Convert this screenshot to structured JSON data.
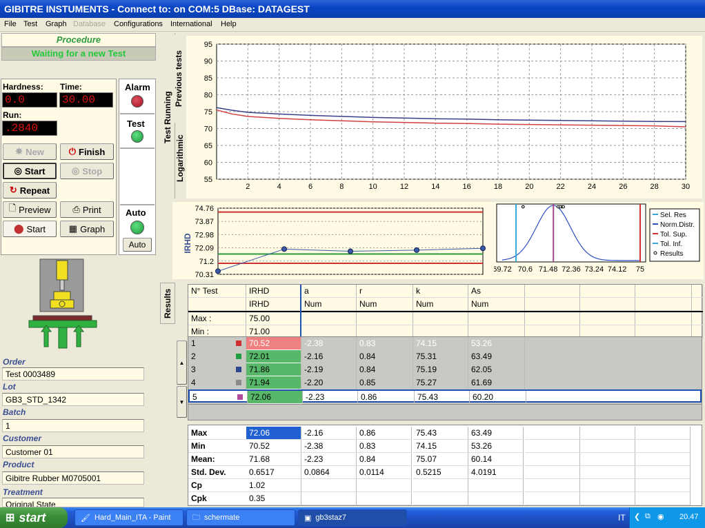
{
  "window": {
    "title": "GIBITRE INSTUMENTS - Connect to:  on COM:5  DBase: DATAGEST"
  },
  "menu": [
    "File",
    "Test",
    "Graph",
    "Database",
    "Configurations",
    "International",
    "Help"
  ],
  "procedure": {
    "title": "Procedure",
    "status": "Waiting for a new Test"
  },
  "readings": {
    "hardness_label": "Hardness:",
    "hardness_value": "0.0",
    "time_label": "Time:",
    "time_value": "30.00",
    "run_label": "Run:",
    "run_value": ".2840"
  },
  "buttons": {
    "new": "New",
    "finish": "Finish",
    "start": "Start",
    "stop": "Stop",
    "repeat": "Repeat",
    "preview": "Preview",
    "print": "Print",
    "start2": "Start",
    "graph": "Graph",
    "auto": "Auto"
  },
  "indicators": {
    "alarm": "Alarm",
    "test": "Test",
    "auto": "Auto"
  },
  "info": {
    "order_label": "Order",
    "order": "Test 0003489",
    "lot_label": "Lot",
    "lot": "GB3_STD_1342",
    "batch_label": "Batch",
    "batch": "1",
    "customer_label": "Customer",
    "customer": "Customer 01",
    "product_label": "Product",
    "product": "Gibitre Rubber M0705001",
    "treatment_label": "Treatment",
    "treatment": "Original State"
  },
  "side_tabs": {
    "previous": "Previous tests",
    "running": "Test Running",
    "log": "Logarithmic",
    "results": "Results"
  },
  "colors": {
    "red_curve": "#d04040",
    "blue_curve": "#3a3d8a",
    "green_led": "#22b24a",
    "red_led": "#b01828",
    "highlight": "#2060d0"
  },
  "chart_data": [
    {
      "type": "line",
      "x_ticks": [
        2,
        4,
        6,
        8,
        10,
        12,
        14,
        16,
        18,
        20,
        22,
        24,
        26,
        28,
        30
      ],
      "y_ticks": [
        55,
        60,
        65,
        70,
        75,
        80,
        85,
        90,
        95
      ],
      "xlim": [
        0,
        30
      ],
      "ylim": [
        55,
        95
      ],
      "grid": true,
      "series": [
        {
          "color": "blue",
          "x": [
            0,
            1,
            2,
            4,
            6,
            8,
            10,
            12,
            14,
            16,
            18,
            20,
            22,
            24,
            26,
            28,
            30
          ],
          "y": [
            76.2,
            75.4,
            74.8,
            74.3,
            73.9,
            73.6,
            73.3,
            73.1,
            72.9,
            72.8,
            72.6,
            72.5,
            72.4,
            72.3,
            72.2,
            72.1,
            72.06
          ]
        },
        {
          "color": "red",
          "x": [
            0,
            1,
            2,
            4,
            6,
            8,
            10,
            12,
            14,
            16,
            18,
            20,
            22,
            24,
            26,
            28,
            30
          ],
          "y": [
            75.5,
            74.3,
            73.6,
            73.0,
            72.6,
            72.3,
            72.0,
            71.8,
            71.6,
            71.5,
            71.3,
            71.2,
            71.1,
            71.0,
            70.9,
            70.8,
            70.52
          ]
        }
      ]
    },
    {
      "type": "line",
      "ylabel": "IRHD",
      "y_ticks": [
        "74.76",
        "73.87",
        "72.98",
        "72.09",
        "71.2",
        "70.31"
      ],
      "ylim": [
        70.31,
        74.76
      ],
      "x": [
        1,
        2,
        3,
        4,
        5
      ],
      "values": [
        70.52,
        72.01,
        71.86,
        71.94,
        72.06
      ],
      "mean": 71.68,
      "upper_limit": 74.5,
      "lower_limit": 71.05
    },
    {
      "type": "line",
      "x_ticks": [
        "69.72",
        "70.6",
        "71.48",
        "72.36",
        "73.24",
        "74.12",
        "75"
      ],
      "xlim": [
        69.72,
        75
      ],
      "legend": [
        "Sel. Res",
        "Norm.Distr.",
        "Tol. Sup.",
        "Tol. Inf.",
        "Results"
      ],
      "legend_position": "right",
      "mean": 71.68,
      "std": 0.6517,
      "sel_res": 71.68,
      "tol_sup": 75.0,
      "tol_inf": 70.25,
      "results": [
        70.52,
        72.01,
        71.86,
        71.94,
        72.06
      ]
    },
    {
      "type": "table",
      "columns": [
        {
          "name": "N° Test",
          "unit": ""
        },
        {
          "name": "IRHD",
          "unit": "IRHD"
        },
        {
          "name": "a",
          "unit": "Num"
        },
        {
          "name": "r",
          "unit": "Num"
        },
        {
          "name": "k",
          "unit": "Num"
        },
        {
          "name": "As",
          "unit": "Num"
        }
      ],
      "limits": {
        "max_label": "Max :",
        "min_label": "Min :",
        "max": "75.00",
        "min": "71.00"
      },
      "rows": [
        {
          "n": "1",
          "swatch": "#d03030",
          "irhd": "70.52",
          "a": "-2.38",
          "r": "0.83",
          "k": "74.15",
          "as": "53.26",
          "fail": true
        },
        {
          "n": "2",
          "swatch": "#20a040",
          "irhd": "72.01",
          "a": "-2.16",
          "r": "0.84",
          "k": "75.31",
          "as": "63.49"
        },
        {
          "n": "3",
          "swatch": "#2c4a8c",
          "irhd": "71.86",
          "a": "-2.19",
          "r": "0.84",
          "k": "75.19",
          "as": "62.05"
        },
        {
          "n": "4",
          "swatch": "#8a8a8a",
          "irhd": "71.94",
          "a": "-2.20",
          "r": "0.85",
          "k": "75.27",
          "as": "61.69"
        },
        {
          "n": "5",
          "swatch": "#b04c9c",
          "irhd": "72.06",
          "a": "-2.23",
          "r": "0.86",
          "k": "75.43",
          "as": "60.20",
          "selected": true
        }
      ],
      "stats": [
        {
          "label": "Max",
          "values": [
            "72.06",
            "-2.16",
            "0.86",
            "75.43",
            "63.49"
          ]
        },
        {
          "label": "Min",
          "values": [
            "70.52",
            "-2.38",
            "0.83",
            "74.15",
            "53.26"
          ]
        },
        {
          "label": "Mean:",
          "values": [
            "71.68",
            "-2.23",
            "0.84",
            "75.07",
            "60.14"
          ]
        },
        {
          "label": "Std. Dev.",
          "values": [
            "0.6517",
            "0.0864",
            "0.0114",
            "0.5215",
            "4.0191"
          ]
        },
        {
          "label": "Cp",
          "values": [
            "1.02",
            "",
            "",
            "",
            ""
          ]
        },
        {
          "label": "Cpk",
          "values": [
            "0.35",
            "",
            "",
            "",
            ""
          ]
        }
      ]
    }
  ],
  "taskbar": {
    "start": "start",
    "items": [
      "Hard_Main_ITA - Paint",
      "schermate",
      "gb3staz7"
    ],
    "lang": "IT",
    "clock": "20.47"
  }
}
